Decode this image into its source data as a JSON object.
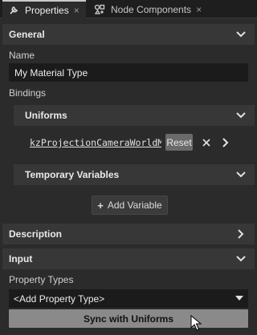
{
  "tabs": [
    {
      "label": "Properties",
      "icon": "wrench-icon",
      "active": true,
      "close": "×"
    },
    {
      "label": "Node Components",
      "icon": "node-components-icon",
      "active": false,
      "close": "×"
    }
  ],
  "sections": {
    "general": {
      "title": "General",
      "expanded": true
    },
    "description": {
      "title": "Description",
      "expanded": false
    },
    "input": {
      "title": "Input",
      "expanded": true
    }
  },
  "fields": {
    "name_label": "Name",
    "name_value": "My Material Type",
    "bindings_label": "Bindings",
    "property_types_label": "Property Types"
  },
  "uniforms": {
    "title": "Uniforms",
    "expanded": true,
    "items": [
      {
        "name": "kzProjectionCameraWorldMatrix",
        "reset_label": "Reset"
      }
    ]
  },
  "temporary_variables": {
    "title": "Temporary Variables",
    "expanded": true,
    "add_label": "Add Variable"
  },
  "property_type_dropdown": {
    "selected": "<Add Property Type>"
  },
  "sync_button": {
    "label": "Sync with Uniforms"
  },
  "colors": {
    "background": "#2b2b2b",
    "section_header": "#373737",
    "field_bg": "#1b1b1b",
    "sync_button": "#8a8a8a",
    "reset_button": "#6a6a6a"
  }
}
